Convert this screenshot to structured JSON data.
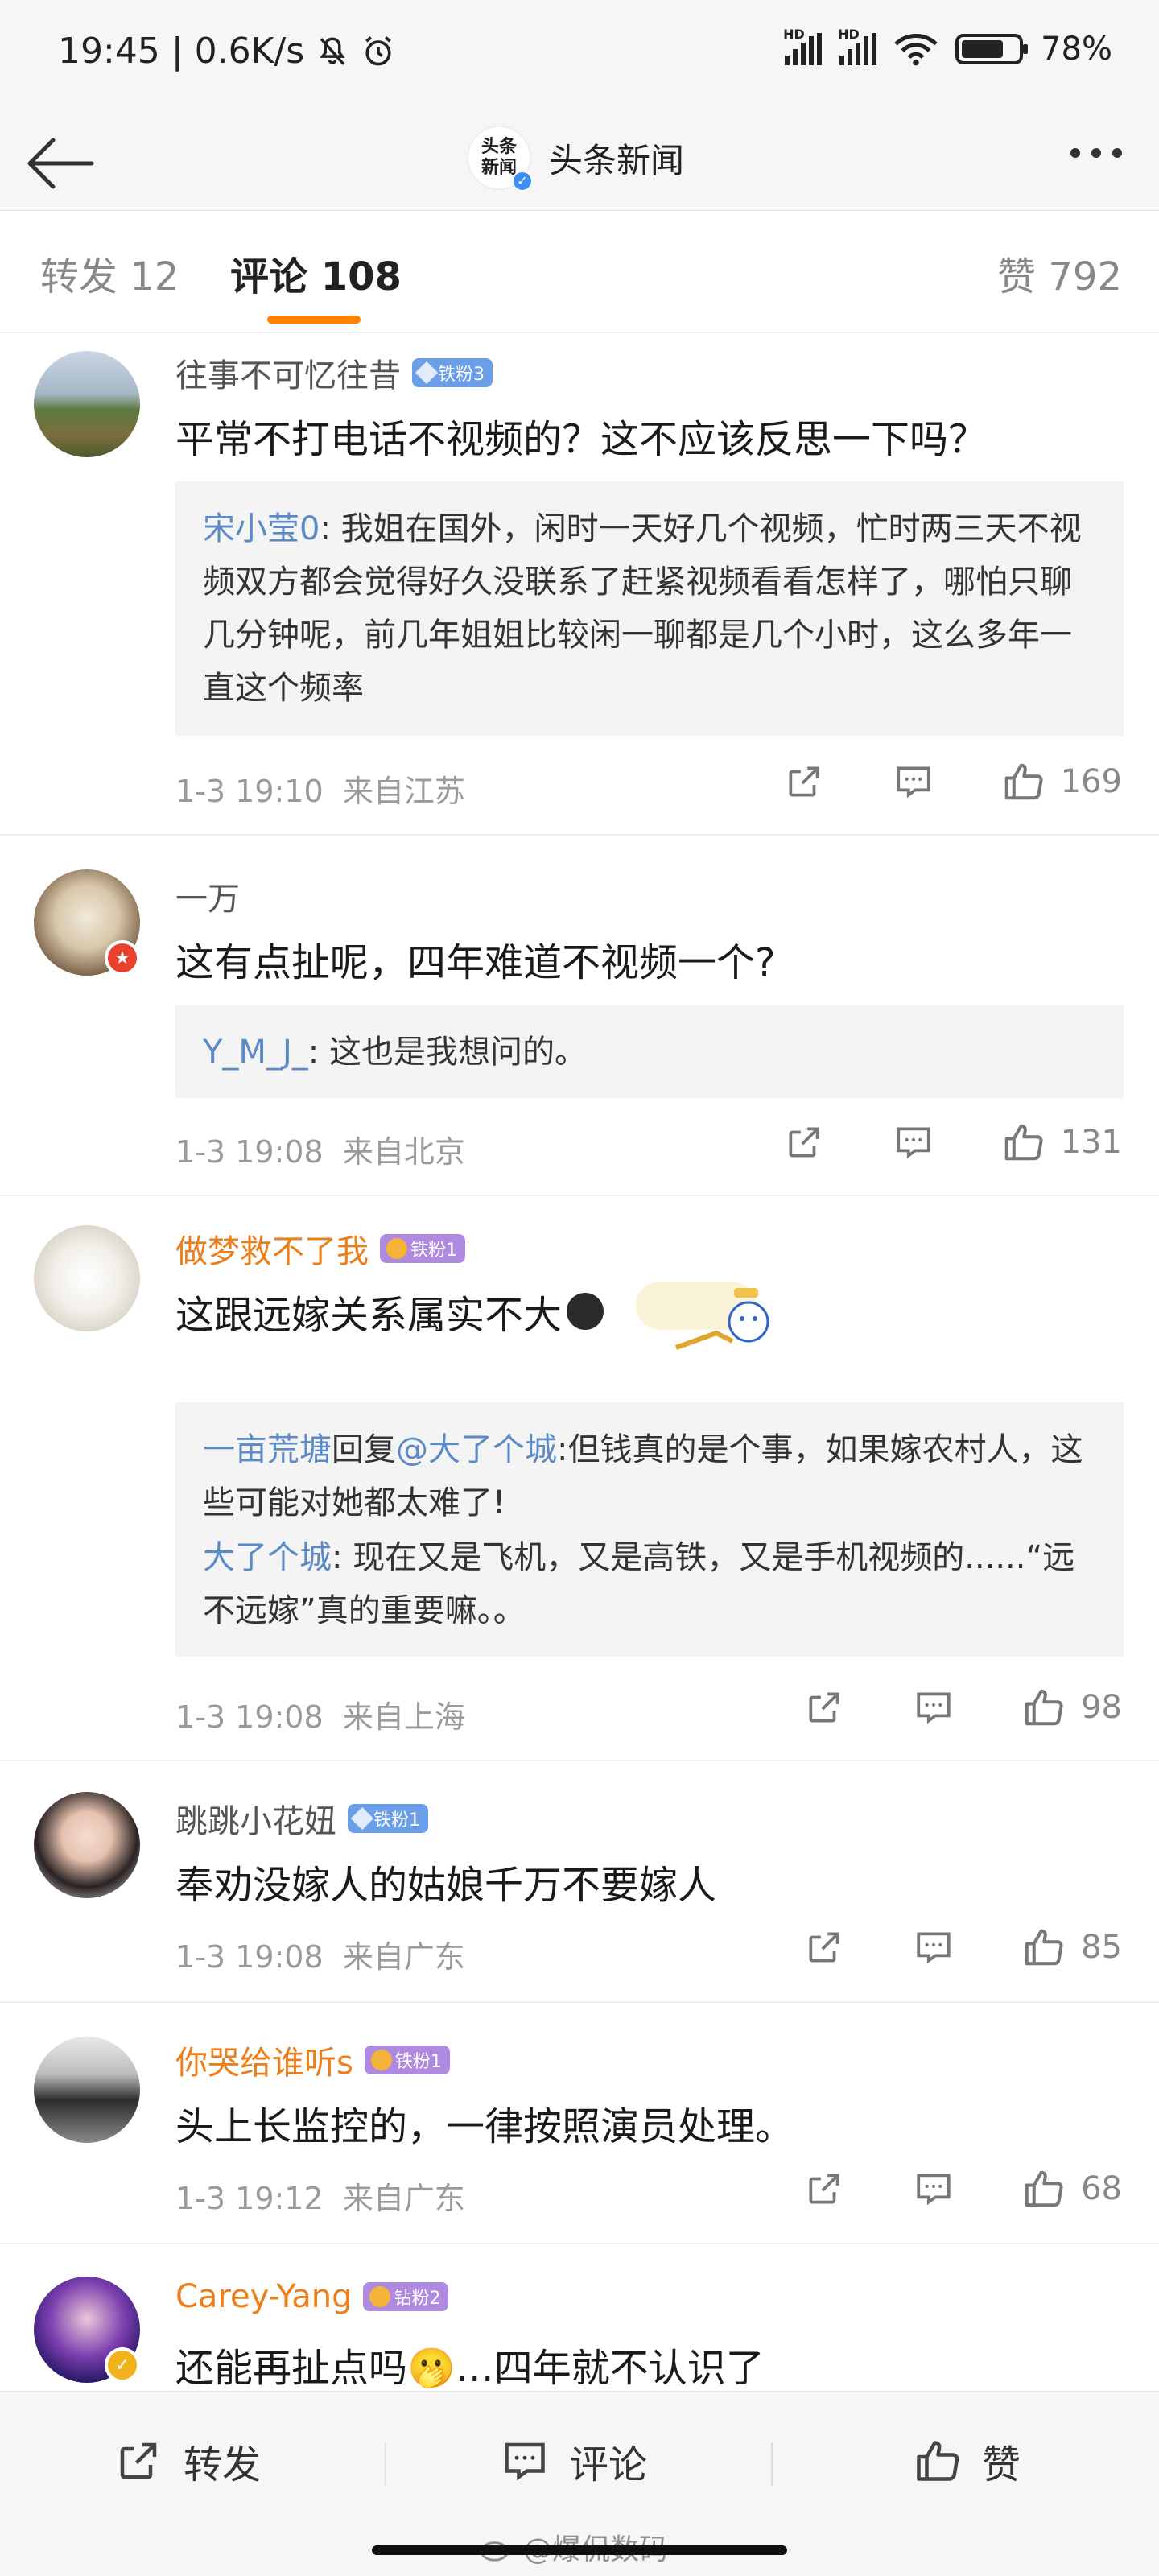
{
  "status_bar": {
    "time_speed": "19:45 | 0.6K/s",
    "network_1": "HD",
    "network_2": "HD",
    "battery": "78%",
    "battery_level": 0.78
  },
  "header": {
    "logo_text": "头条新闻",
    "title": "头条新闻"
  },
  "tabs": {
    "repost": "转发 12",
    "comments": "评论 108",
    "likes": "赞 792"
  },
  "comments": [
    {
      "username": "往事不可忆往昔",
      "badge": "铁粉3",
      "text": "平常不打电话不视频的？这不应该反思一下吗？",
      "replies": [
        {
          "name": "宋小莹0",
          "text": ": 我姐在国外，闲时一天好几个视频，忙时两三天不视频双方都会觉得好久没联系了赶紧视频看看怎样了，哪怕只聊几分钟呢，前几年姐姐比较闲一聊都是几个小时，这么多年一直这个频率"
        }
      ],
      "time": "1-3 19:10",
      "location": "来自江苏",
      "likes": "169"
    },
    {
      "username": "一万",
      "badge": "",
      "text": "这有点扯呢，四年难道不视频一个?",
      "replies": [
        {
          "name": "Y_M_J_",
          "text": ": 这也是我想问的。"
        }
      ],
      "time": "1-3 19:08",
      "location": "来自北京",
      "likes": "131"
    },
    {
      "username": "做梦救不了我",
      "badge": "铁粉1",
      "text": "这跟远嫁关系属实不大",
      "replies": [
        {
          "name": "一亩荒塘",
          "reply_word": "回复",
          "target": "@大了个城",
          "text": ":但钱真的是个事，如果嫁农村人，这些可能对她都太难了!"
        },
        {
          "name": "大了个城",
          "text": ": 现在又是飞机，又是高铁，又是手机视频的......“远不远嫁”真的重要嘛。。"
        }
      ],
      "time": "1-3 19:08",
      "location": "来自上海",
      "likes": "98"
    },
    {
      "username": "跳跳小花妞",
      "badge": "铁粉1",
      "text": "奉劝没嫁人的姑娘千万不要嫁人",
      "time": "1-3 19:08",
      "location": "来自广东",
      "likes": "85"
    },
    {
      "username": "你哭给谁听s",
      "badge": "铁粉1",
      "text": "头上长监控的，一律按照演员处理。",
      "time": "1-3 19:12",
      "location": "来自广东",
      "likes": "68"
    },
    {
      "username": "Carey-Yang",
      "badge": "钻粉2",
      "text": "还能再扯点吗🫢…四年就不认识了"
    }
  ],
  "bottom_bar": {
    "repost": "转发",
    "comment": "评论",
    "like": "赞"
  },
  "watermark": "@爆侃数码",
  "colors": {
    "accent": "#ff8200",
    "reply_name": "#5b8ac6",
    "vip_username": "#eb7f1b",
    "fan_badge": "#6a9ee8"
  }
}
